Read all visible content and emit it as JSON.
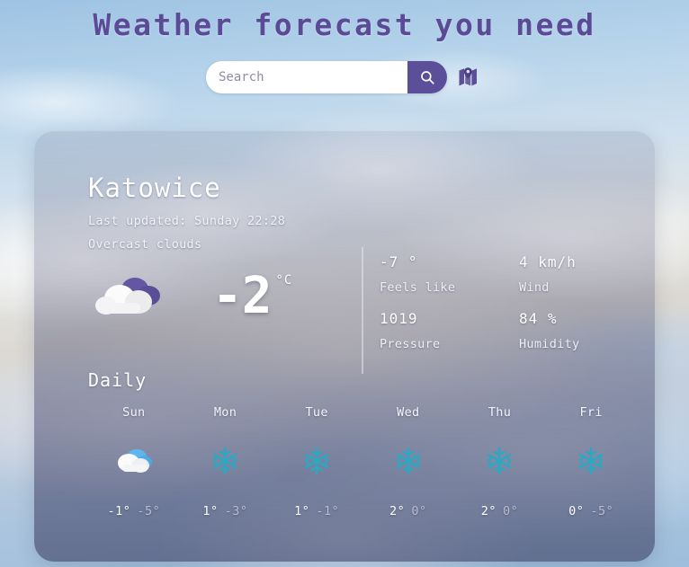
{
  "header": {
    "title": "Weather forecast you need",
    "title_color": "#5b4a96"
  },
  "search": {
    "placeholder": "Search",
    "value": "",
    "button_icon": "search-icon",
    "button_color": "#5c4f99",
    "map_icon": "map-pin-icon"
  },
  "current": {
    "city": "Katowice",
    "last_updated": "Last updated: Sunday 22:28",
    "description": "Overcast clouds",
    "icon": "overcast-clouds-icon",
    "temperature": "-2",
    "unit": "°C",
    "stats": [
      {
        "key": "feels-like",
        "value": "-7 °",
        "label": "Feels like"
      },
      {
        "key": "wind",
        "value": "4 km/h",
        "label": "Wind"
      },
      {
        "key": "pressure",
        "value": "1019",
        "label": "Pressure"
      },
      {
        "key": "humidity",
        "value": "84 %",
        "label": "Humidity"
      }
    ]
  },
  "daily": {
    "title": "Daily",
    "days": [
      {
        "name": "Sun",
        "icon": "cloud-icon",
        "high": "-1°",
        "low": "-5°"
      },
      {
        "name": "Mon",
        "icon": "snowflake-icon",
        "high": "1°",
        "low": "-3°"
      },
      {
        "name": "Tue",
        "icon": "snowflake-icon",
        "high": "1°",
        "low": "-1°"
      },
      {
        "name": "Wed",
        "icon": "snowflake-icon",
        "high": "2°",
        "low": "0°"
      },
      {
        "name": "Thu",
        "icon": "snowflake-icon",
        "high": "2°",
        "low": "0°"
      },
      {
        "name": "Fri",
        "icon": "snowflake-icon",
        "high": "0°",
        "low": "-5°"
      }
    ]
  }
}
